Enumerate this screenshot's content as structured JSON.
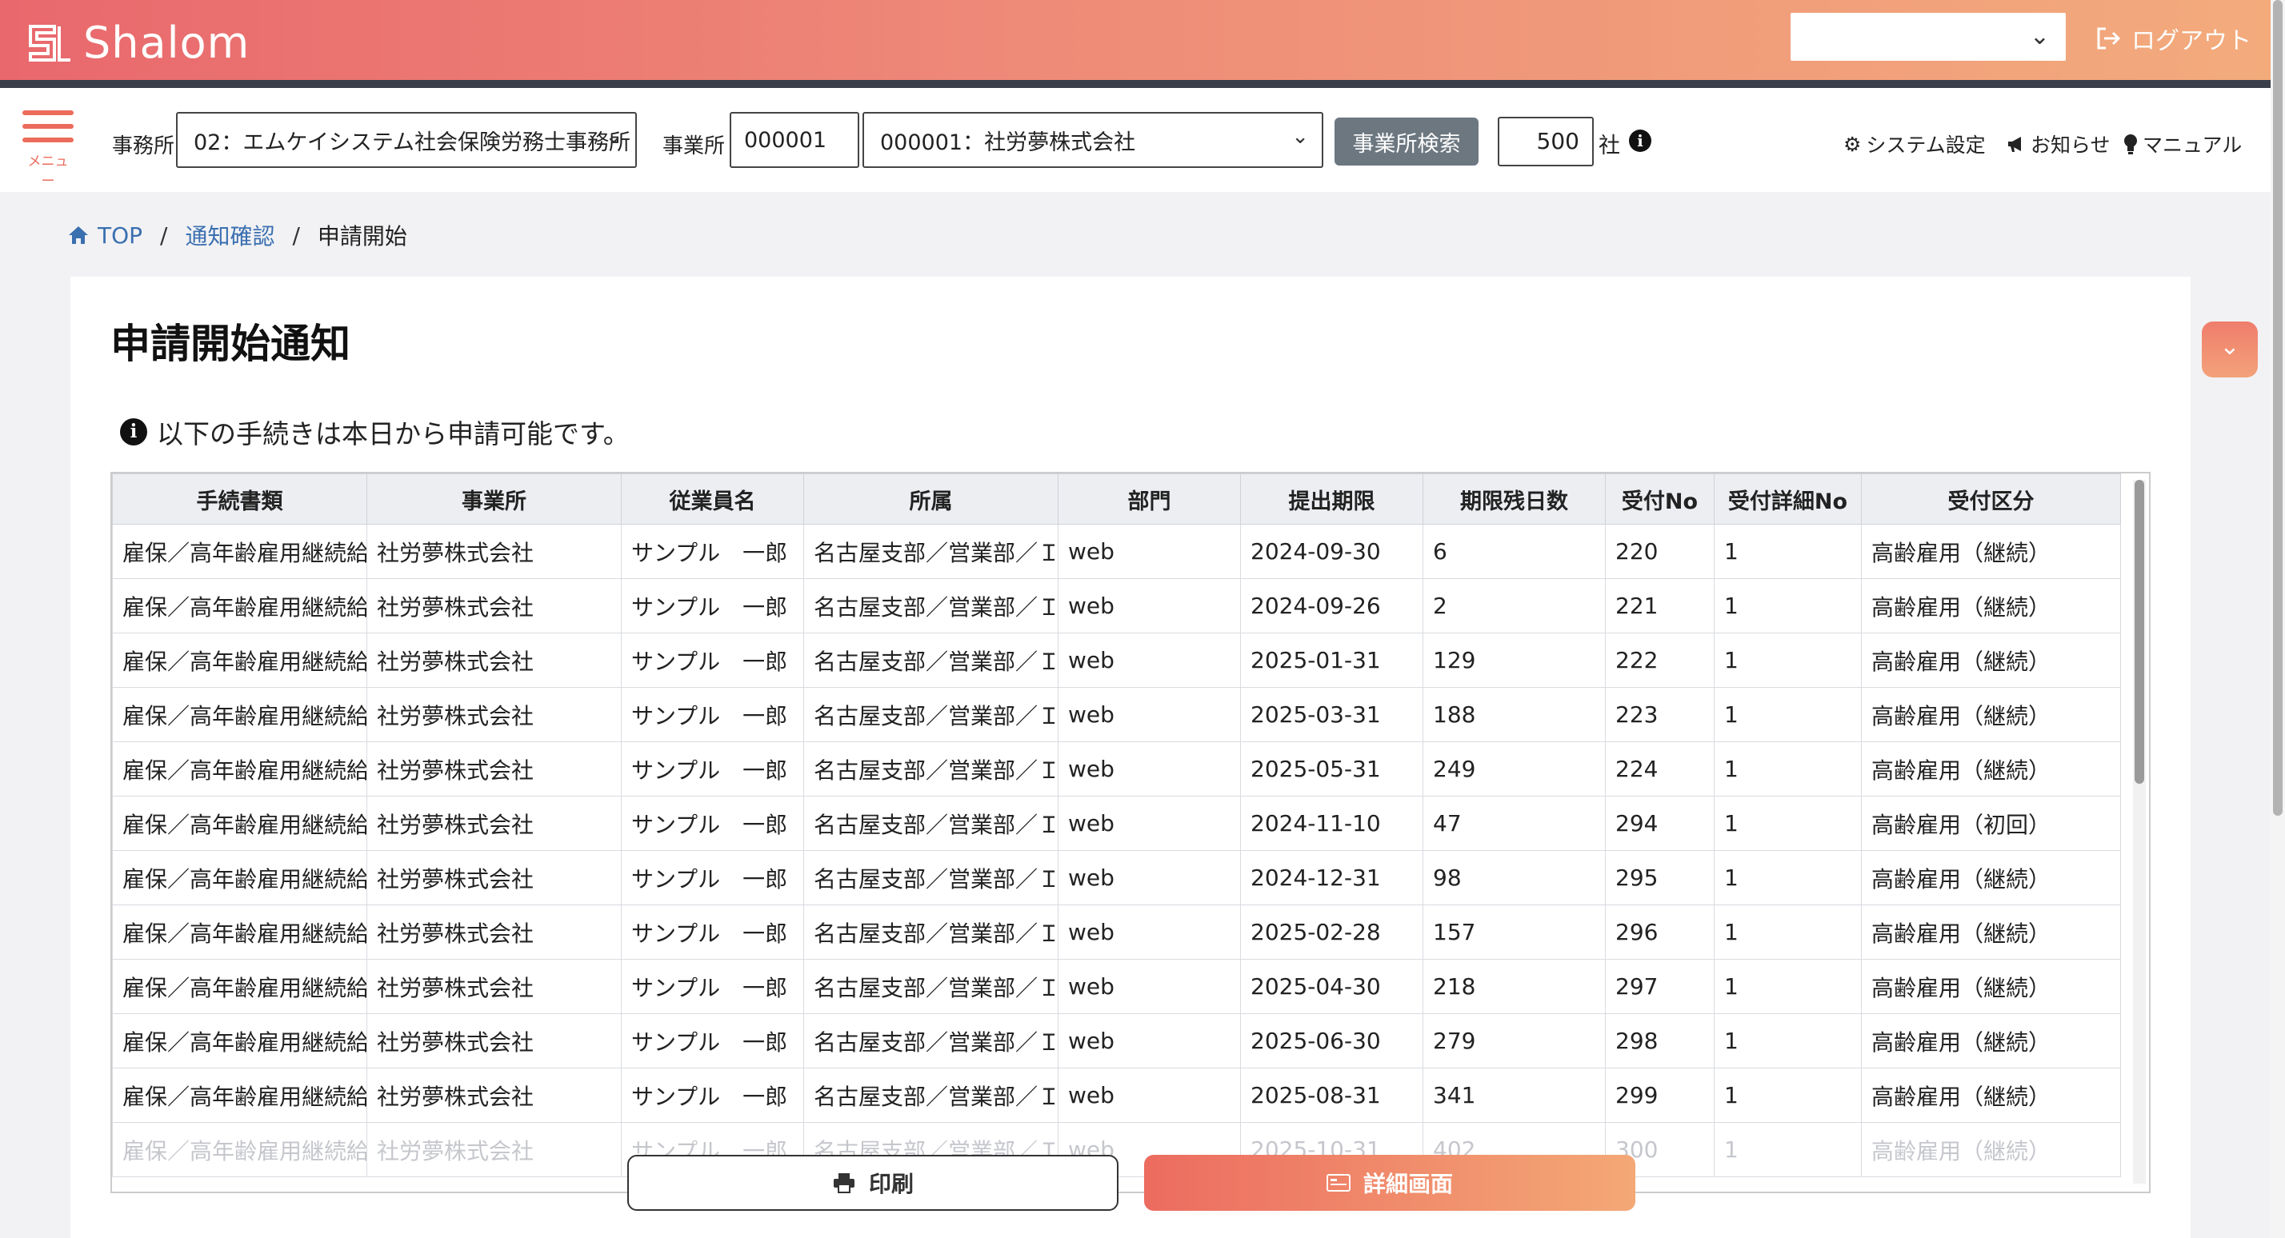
{
  "app": {
    "name": "Shalom"
  },
  "header": {
    "logout_label": "ログアウト",
    "top_select_value": ""
  },
  "toolbar": {
    "menu_label": "メニュー",
    "office_label": "事務所",
    "office_value": "02：エムケイシステム社会保険労務士事務所",
    "site_label": "事業所",
    "site_code": "000001",
    "site_value": "000001：社労夢株式会社",
    "search_button": "事業所検索",
    "company_count": "500",
    "company_unit": "社",
    "system_settings": "システム設定",
    "notices": "お知らせ",
    "manual": "マニュアル"
  },
  "breadcrumb": {
    "top": "TOP",
    "notice_confirm": "通知確認",
    "current": "申請開始"
  },
  "page": {
    "title": "申請開始通知",
    "notice": "以下の手続きは本日から申請可能です。"
  },
  "table": {
    "headers": [
      "手続書類",
      "事業所",
      "従業員名",
      "所属",
      "部門",
      "提出期限",
      "期限残日数",
      "受付No",
      "受付詳細No",
      "受付区分"
    ],
    "rows": [
      [
        "雇保／高年齢雇用継続給付",
        "社労夢株式会社",
        "サンプル　一郎",
        "名古屋支部／営業部／Ｉ",
        "web",
        "2024-09-30",
        "6",
        "220",
        "1",
        "高齢雇用（継続）"
      ],
      [
        "雇保／高年齢雇用継続給付",
        "社労夢株式会社",
        "サンプル　一郎",
        "名古屋支部／営業部／Ｉ",
        "web",
        "2024-09-26",
        "2",
        "221",
        "1",
        "高齢雇用（継続）"
      ],
      [
        "雇保／高年齢雇用継続給付",
        "社労夢株式会社",
        "サンプル　一郎",
        "名古屋支部／営業部／Ｉ",
        "web",
        "2025-01-31",
        "129",
        "222",
        "1",
        "高齢雇用（継続）"
      ],
      [
        "雇保／高年齢雇用継続給付",
        "社労夢株式会社",
        "サンプル　一郎",
        "名古屋支部／営業部／Ｉ",
        "web",
        "2025-03-31",
        "188",
        "223",
        "1",
        "高齢雇用（継続）"
      ],
      [
        "雇保／高年齢雇用継続給付",
        "社労夢株式会社",
        "サンプル　一郎",
        "名古屋支部／営業部／Ｉ",
        "web",
        "2025-05-31",
        "249",
        "224",
        "1",
        "高齢雇用（継続）"
      ],
      [
        "雇保／高年齢雇用継続給付",
        "社労夢株式会社",
        "サンプル　一郎",
        "名古屋支部／営業部／Ｉ",
        "web",
        "2024-11-10",
        "47",
        "294",
        "1",
        "高齢雇用（初回）"
      ],
      [
        "雇保／高年齢雇用継続給付",
        "社労夢株式会社",
        "サンプル　一郎",
        "名古屋支部／営業部／Ｉ",
        "web",
        "2024-12-31",
        "98",
        "295",
        "1",
        "高齢雇用（継続）"
      ],
      [
        "雇保／高年齢雇用継続給付",
        "社労夢株式会社",
        "サンプル　一郎",
        "名古屋支部／営業部／Ｉ",
        "web",
        "2025-02-28",
        "157",
        "296",
        "1",
        "高齢雇用（継続）"
      ],
      [
        "雇保／高年齢雇用継続給付",
        "社労夢株式会社",
        "サンプル　一郎",
        "名古屋支部／営業部／Ｉ",
        "web",
        "2025-04-30",
        "218",
        "297",
        "1",
        "高齢雇用（継続）"
      ],
      [
        "雇保／高年齢雇用継続給付",
        "社労夢株式会社",
        "サンプル　一郎",
        "名古屋支部／営業部／Ｉ",
        "web",
        "2025-06-30",
        "279",
        "298",
        "1",
        "高齢雇用（継続）"
      ],
      [
        "雇保／高年齢雇用継続給付",
        "社労夢株式会社",
        "サンプル　一郎",
        "名古屋支部／営業部／Ｉ",
        "web",
        "2025-08-31",
        "341",
        "299",
        "1",
        "高齢雇用（継続）"
      ],
      [
        "雇保／高年齢雇用継続給付",
        "社労夢株式会社",
        "サンプル　一郎",
        "名古屋支部／営業部／Ｉ",
        "web",
        "2025-10-31",
        "402",
        "300",
        "1",
        "高齢雇用（継続）"
      ]
    ]
  },
  "actions": {
    "print_label": "印刷",
    "detail_label": "詳細画面"
  },
  "colors": {
    "accent": "#ec6c5c",
    "link": "#3a6fb0",
    "header_gradient_start": "#e9686d",
    "header_gradient_end": "#f3ab7c"
  }
}
